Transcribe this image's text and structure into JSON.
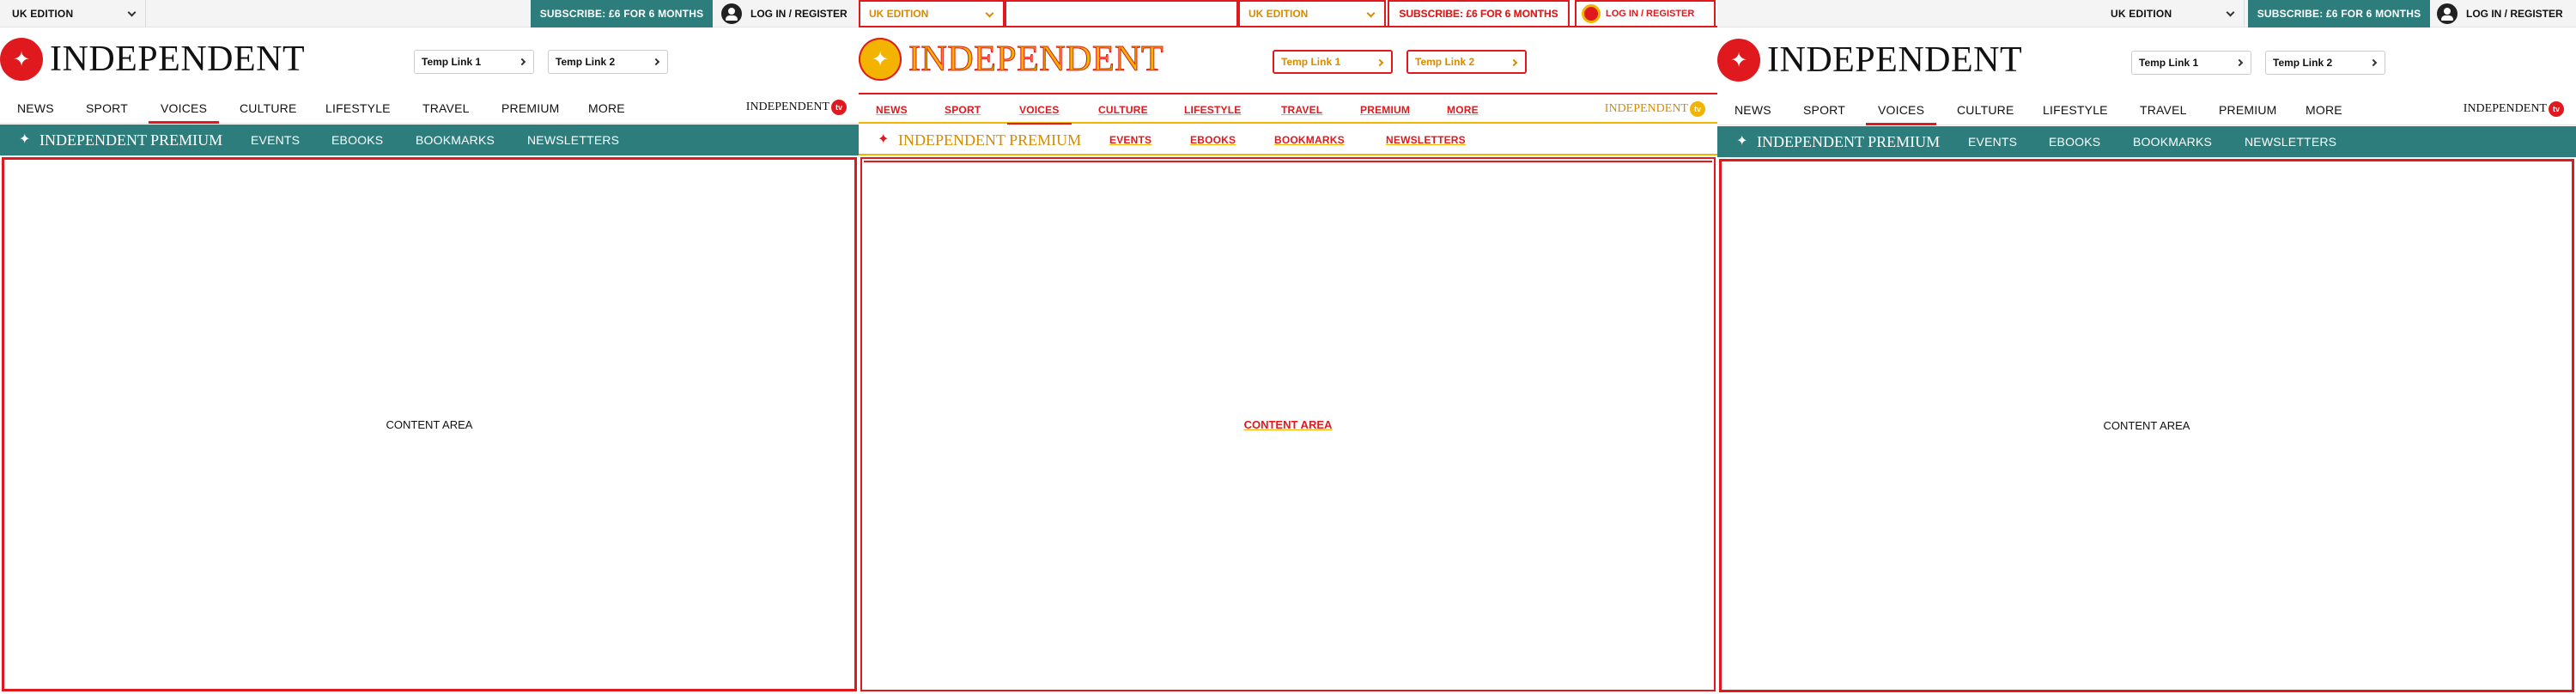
{
  "topbar": {
    "edition_label": "UK EDITION",
    "subscribe_label": "SUBSCRIBE: £6 FOR 6 MONTHS",
    "login_label": "LOG IN / REGISTER"
  },
  "header": {
    "logo_text": "INDEPENDENT",
    "temp_links": [
      "Temp Link 1",
      "Temp Link 2"
    ]
  },
  "nav": {
    "items": [
      "NEWS",
      "SPORT",
      "VOICES",
      "CULTURE",
      "LIFESTYLE",
      "TRAVEL",
      "PREMIUM",
      "MORE"
    ],
    "active": "VOICES",
    "tv_logo_text": "INDEPENDENT",
    "tv_badge": "tv"
  },
  "premium_bar": {
    "logo_text": "INDEPENDENT PREMIUM",
    "items": [
      "EVENTS",
      "EBOOKS",
      "BOOKMARKS",
      "NEWSLETTERS"
    ]
  },
  "content": {
    "label": "CONTENT AREA"
  },
  "colors": {
    "brand_red": "#e0191e",
    "premium_teal": "#2e7d7d",
    "glitch_yellow": "#f2b400"
  }
}
